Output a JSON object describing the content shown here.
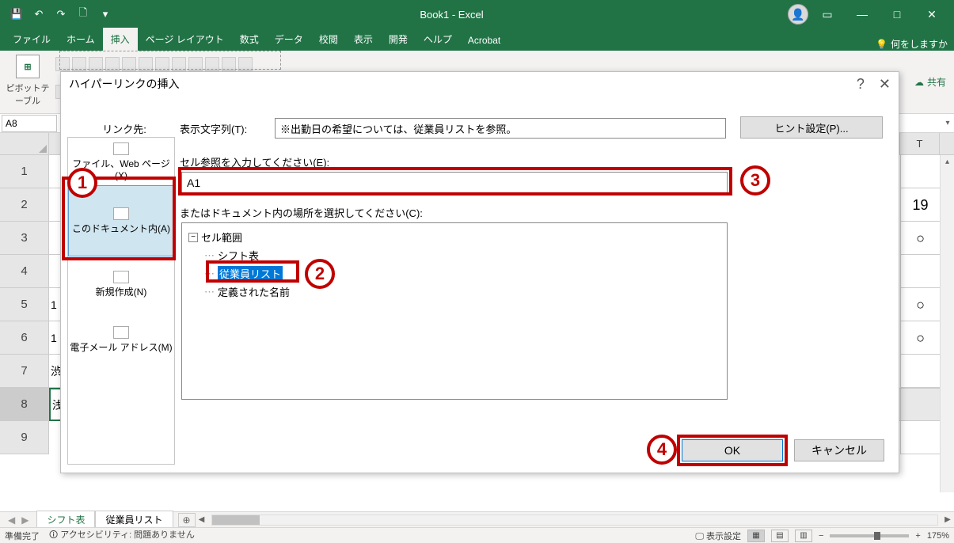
{
  "title": "Book1 - Excel",
  "qat": {
    "save": "💾",
    "undo": "↶",
    "redo": "↷",
    "new": "🗋",
    "more": "▾"
  },
  "tabs": [
    "ファイル",
    "ホーム",
    "挿入",
    "ページ レイアウト",
    "数式",
    "データ",
    "校閲",
    "表示",
    "開発",
    "ヘルプ",
    "Acrobat"
  ],
  "active_tab": "挿入",
  "tellme_icon": "💡",
  "tellme": "何をしますか",
  "share_icon": "☁",
  "share": "共有",
  "ribbon_btn1": "ピボットテーブル",
  "namebox": "A8",
  "col_T": "T",
  "rows": [
    "1",
    "2",
    "3",
    "4",
    "5",
    "6",
    "7",
    "8",
    "9"
  ],
  "cells_left": [
    "",
    "",
    "",
    "",
    "1",
    "1",
    "渋",
    "浅",
    ""
  ],
  "cells_T": [
    "",
    "19",
    "○",
    "",
    "○",
    "○",
    "",
    "",
    ""
  ],
  "sheet_tabs": [
    "シフト表",
    "従業員リスト"
  ],
  "active_sheet": "シフト表",
  "status_ready": "準備完了",
  "status_acc": "アクセシビリティ: 問題ありません",
  "status_display": "表示設定",
  "zoom": "175%",
  "dialog": {
    "title": "ハイパーリンクの挿入",
    "help": "?",
    "close": "✕",
    "link_to": "リンク先:",
    "opt_file": "ファイル、Web ページ(X)",
    "opt_doc": "このドキュメント内(A)",
    "opt_new": "新規作成(N)",
    "opt_mail": "電子メール アドレス(M)",
    "display_label": "表示文字列(T):",
    "display_value": "※出勤日の希望については、従業員リストを参照。",
    "screentip": "ヒント設定(P)...",
    "cellref_label": "セル参照を入力してください(E):",
    "cellref_value": "A1",
    "doc_label": "またはドキュメント内の場所を選択してください(C):",
    "tree_root": "セル範囲",
    "tree_sheet1": "シフト表",
    "tree_sheet2": "従業員リスト",
    "tree_names": "定義された名前",
    "ok": "OK",
    "cancel": "キャンセル"
  },
  "callouts": {
    "1": "1",
    "2": "2",
    "3": "3",
    "4": "4"
  }
}
